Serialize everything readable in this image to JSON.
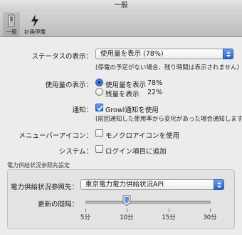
{
  "window": {
    "title": "一般"
  },
  "toolbar": {
    "items": [
      {
        "label": "一般",
        "icon": "switch-icon"
      },
      {
        "label": "計画停電",
        "icon": "lightning-icon"
      }
    ]
  },
  "status_display": {
    "label": "ステータスの表示：",
    "selected": "使用量を表示 (78%)",
    "note": "(停電の予定がない場合、残り時間は表示されません)"
  },
  "usage_display": {
    "label": "使用量の表示：",
    "options": [
      {
        "label": "使用量を表示",
        "value": "78%",
        "selected": true
      },
      {
        "label": "残量を表示",
        "value": "22%",
        "selected": false
      }
    ]
  },
  "notification": {
    "label": "通知：",
    "checkbox_label": "Growl通知を使用",
    "checked": true,
    "note": "(前回通知した使用率から変化があった場合通知します)"
  },
  "menubar_icon": {
    "label": "メニューバーアイコン：",
    "checkbox_label": "モノクロアイコンを使用",
    "checked": false
  },
  "system": {
    "label": "システム：",
    "checkbox_label": "ログイン項目に追加",
    "checked": false
  },
  "power_source_section": {
    "title": "電力供給状況参照先設定",
    "source_label": "電力供給状況参照先：",
    "source_selected": "東京電力電力供給状況API",
    "interval_label": "更新の間隔：",
    "interval_minutes": 10,
    "ticks": [
      "5分",
      "10分",
      "15分",
      "30分"
    ]
  },
  "colors": {
    "accent": "#2b64c9",
    "background": "#ececec"
  }
}
